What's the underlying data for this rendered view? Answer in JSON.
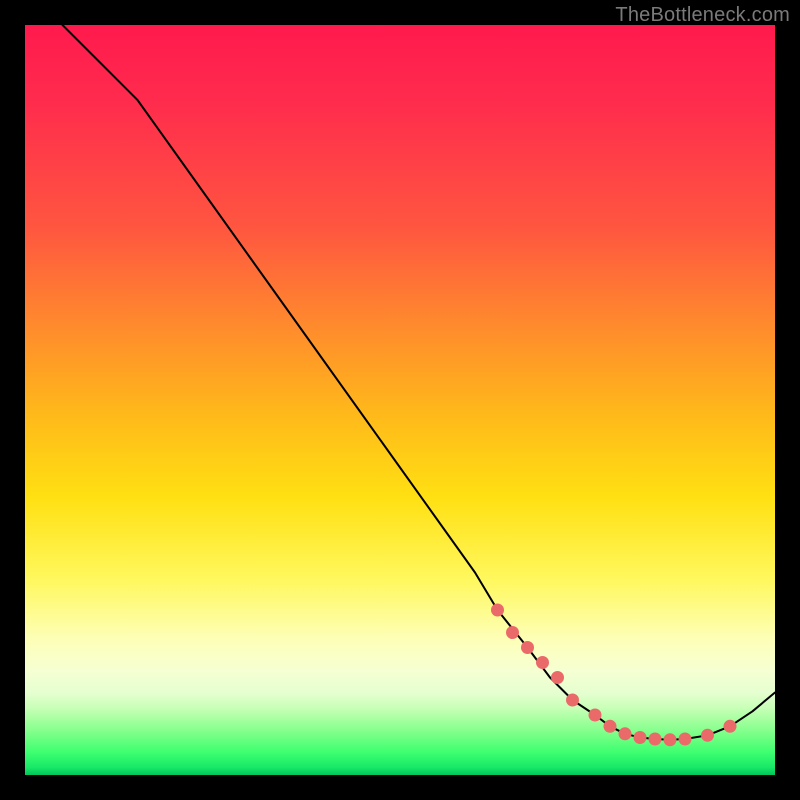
{
  "watermark": "TheBottleneck.com",
  "colors": {
    "dot": "#ea6a6a",
    "curve": "#000000",
    "background": "#000000"
  },
  "chart_data": {
    "type": "line",
    "title": "",
    "xlabel": "",
    "ylabel": "",
    "xlim": [
      0,
      100
    ],
    "ylim": [
      0,
      100
    ],
    "series": [
      {
        "name": "bottleneck-curve",
        "x": [
          5,
          10,
          15,
          20,
          25,
          30,
          35,
          40,
          45,
          50,
          55,
          60,
          63,
          67,
          70,
          73,
          76,
          78,
          80,
          82,
          84,
          86,
          88,
          91,
          94,
          97,
          100
        ],
        "y": [
          100,
          95,
          90,
          83,
          76,
          69,
          62,
          55,
          48,
          41,
          34,
          27,
          22,
          17,
          13,
          10,
          8,
          6.5,
          5.5,
          5,
          4.8,
          4.7,
          4.8,
          5.3,
          6.5,
          8.5,
          11
        ]
      }
    ],
    "markers": {
      "name": "highlight-range",
      "x": [
        63,
        65,
        67,
        69,
        71,
        73,
        76,
        78,
        80,
        82,
        84,
        86,
        88,
        91,
        94
      ],
      "y": [
        22,
        19,
        17,
        15,
        13,
        10,
        8,
        6.5,
        5.5,
        5,
        4.8,
        4.7,
        4.8,
        5.3,
        6.5
      ]
    }
  }
}
